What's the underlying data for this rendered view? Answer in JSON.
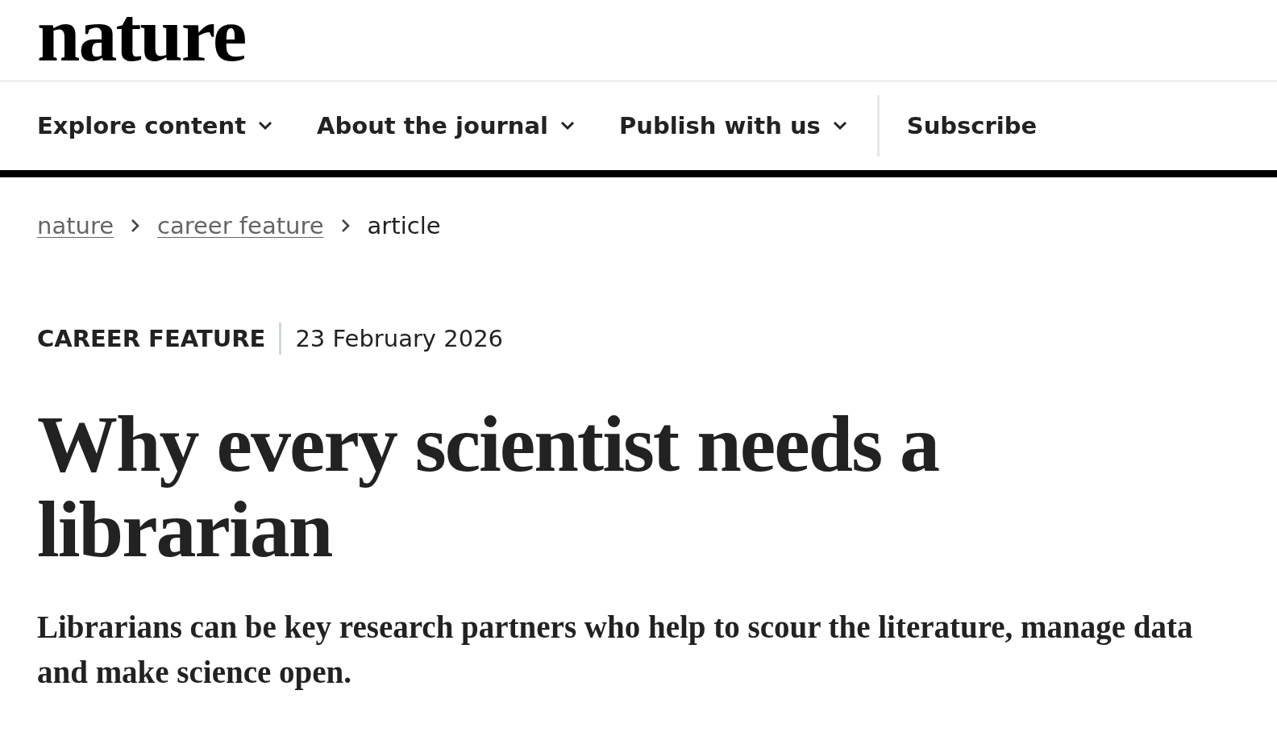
{
  "logo": "nature",
  "nav": [
    {
      "label": "Explore content",
      "dropdown": true
    },
    {
      "label": "About the journal",
      "dropdown": true
    },
    {
      "label": "Publish with us",
      "dropdown": true
    },
    {
      "label": "Subscribe",
      "dropdown": false
    }
  ],
  "breadcrumbs": [
    {
      "label": "nature",
      "link": true
    },
    {
      "label": "career feature",
      "link": true
    },
    {
      "label": "article",
      "link": false
    }
  ],
  "article": {
    "category": "CAREER FEATURE",
    "date": "23 February 2026",
    "title": "Why every scientist needs a librarian",
    "standfirst": "Librarians can be key research partners who help to scour the literature, manage data and make science open."
  }
}
